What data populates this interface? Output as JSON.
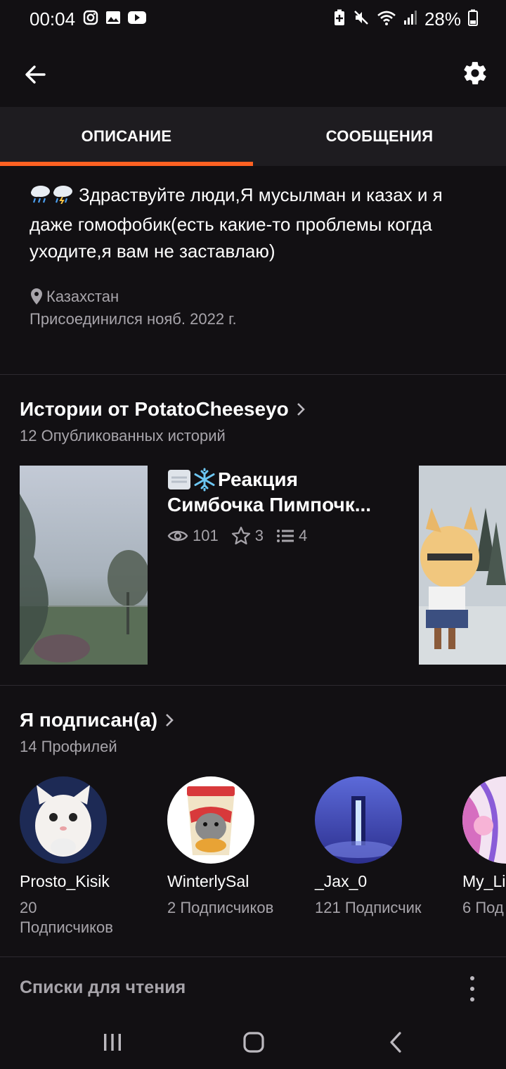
{
  "status_bar": {
    "time": "00:04",
    "battery": "28%",
    "left_icons": [
      "instagram-icon",
      "gallery-icon",
      "youtube-icon"
    ],
    "right_icons": [
      "battery-saver-icon",
      "mute-icon",
      "wifi-icon",
      "signal-icon",
      "battery-icon"
    ]
  },
  "top_bar": {
    "back_icon": "arrow-left-icon",
    "settings_icon": "gear-icon"
  },
  "tabs": [
    {
      "label": "ОПИСАНИЕ",
      "active": true
    },
    {
      "label": "СООБЩЕНИЯ",
      "active": false
    }
  ],
  "accent_color": "#ff6122",
  "about": {
    "text": "Здраствуйте люди,Я мусылман и казах и я даже гомофобик(есть какие-то проблемы когда уходите,я вам не заставлаю)",
    "location": "Казахстан",
    "joined": "Присоединился нояб. 2022 г."
  },
  "stories_section": {
    "title": "Истории от PotatoCheeseyo",
    "subtitle": "12 Опубликованных историй",
    "story": {
      "title_line1": "Реакция",
      "title_line2": "Симбочка Пимпочк...",
      "views": "101",
      "votes": "3",
      "parts": "4"
    }
  },
  "following_section": {
    "title": "Я подписан(а)",
    "subtitle": "14 Профилей",
    "profiles": [
      {
        "name": "Prosto_Kisik",
        "followers": "20",
        "followers_line2": "Подписчиков"
      },
      {
        "name": "WinterlySal",
        "followers": "2 Подписчиков"
      },
      {
        "name": "_Jax_0",
        "followers": "121 Подписчик"
      },
      {
        "name": "My_Li",
        "followers": "6 Под"
      }
    ]
  },
  "reading_lists": {
    "title": "Списки для чтения"
  }
}
